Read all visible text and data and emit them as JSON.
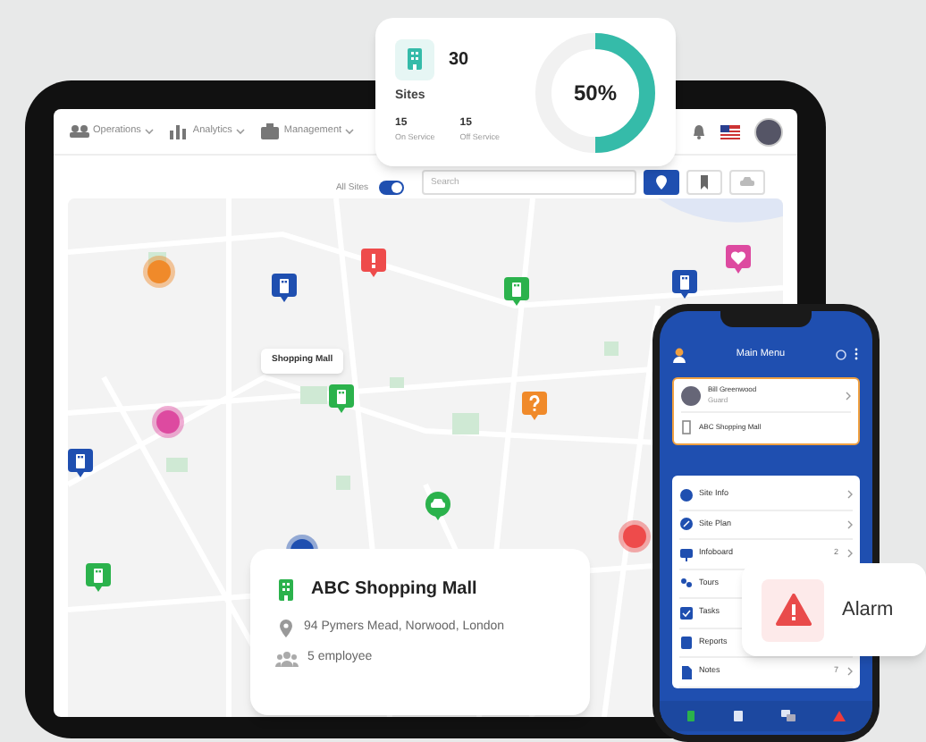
{
  "tablet": {
    "nav": [
      {
        "label": "Operations"
      },
      {
        "label": "Analytics"
      },
      {
        "label": "Management"
      }
    ],
    "filter": {
      "label": "All Sites",
      "on": true
    },
    "search": {
      "placeholder": "Search"
    },
    "view_buttons": [
      {
        "kind": "pin",
        "selected": true
      },
      {
        "kind": "bookmark",
        "selected": false
      },
      {
        "kind": "car",
        "selected": false
      }
    ],
    "map": {
      "label": "Shopping Mall"
    }
  },
  "sites_card": {
    "count": "30",
    "label": "Sites",
    "stats": [
      {
        "value": "15",
        "label": "On Service"
      },
      {
        "value": "15",
        "label": "Off Service"
      }
    ],
    "percent": "50%",
    "level": 0.5
  },
  "phone": {
    "title": "Main Menu",
    "profile": {
      "name": "Bill Greenwood",
      "role": "Guard",
      "site": "ABC Shopping Mall"
    },
    "menu": [
      {
        "label": "Site Info"
      },
      {
        "label": "Site Plan"
      },
      {
        "label": "Infoboard",
        "count": "2"
      },
      {
        "label": "Tours"
      },
      {
        "label": "Tasks"
      },
      {
        "label": "Reports"
      },
      {
        "label": "Notes",
        "count": "7"
      }
    ]
  },
  "alarm_card": {
    "label": "Alarm"
  },
  "site_card": {
    "name": "ABC Shopping Mall",
    "address": "94 Pymers Mead, Norwood, London",
    "employees": "5 employee"
  }
}
